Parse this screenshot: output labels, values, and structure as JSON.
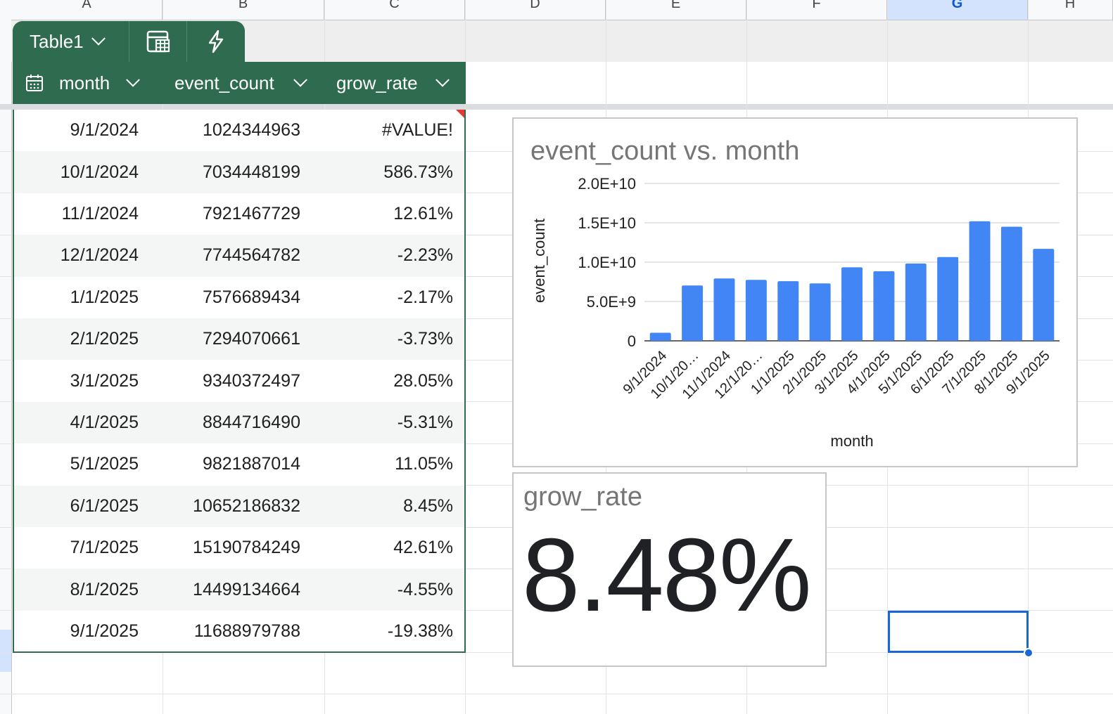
{
  "columns": [
    "A",
    "B",
    "C",
    "D",
    "E",
    "F",
    "G",
    "H"
  ],
  "selected_column": "G",
  "table": {
    "name": "Table1",
    "headers": [
      "month",
      "event_count",
      "grow_rate"
    ],
    "rows": [
      [
        "9/1/2024",
        "1024344963",
        "#VALUE!"
      ],
      [
        "10/1/2024",
        "7034448199",
        "586.73%"
      ],
      [
        "11/1/2024",
        "7921467729",
        "12.61%"
      ],
      [
        "12/1/2024",
        "7744564782",
        "-2.23%"
      ],
      [
        "1/1/2025",
        "7576689434",
        "-2.17%"
      ],
      [
        "2/1/2025",
        "7294070661",
        "-3.73%"
      ],
      [
        "3/1/2025",
        "9340372497",
        "28.05%"
      ],
      [
        "4/1/2025",
        "8844716490",
        "-5.31%"
      ],
      [
        "5/1/2025",
        "9821887014",
        "11.05%"
      ],
      [
        "6/1/2025",
        "10652186832",
        "8.45%"
      ],
      [
        "7/1/2025",
        "15190784249",
        "42.61%"
      ],
      [
        "8/1/2025",
        "14499134664",
        "-4.55%"
      ],
      [
        "9/1/2025",
        "11688979788",
        "-19.38%"
      ]
    ]
  },
  "chart_data": {
    "type": "bar",
    "title": "event_count vs. month",
    "xlabel": "month",
    "ylabel": "event_count",
    "categories": [
      "9/1/2024",
      "10/1/20…",
      "11/1/2024",
      "12/1/20…",
      "1/1/2025",
      "2/1/2025",
      "3/1/2025",
      "4/1/2025",
      "5/1/2025",
      "6/1/2025",
      "7/1/2025",
      "8/1/2025",
      "9/1/2025"
    ],
    "values": [
      1024344963,
      7034448199,
      7921467729,
      7744564782,
      7576689434,
      7294070661,
      9340372497,
      8844716490,
      9821887014,
      10652186832,
      15190784249,
      14499134664,
      11688979788
    ],
    "yticks": [
      "0",
      "5.0E+9",
      "1.0E+10",
      "1.5E+10",
      "2.0E+10"
    ],
    "ylim": [
      0,
      20000000000
    ],
    "bar_color": "#4285f4",
    "grid": true
  },
  "scorecard": {
    "title": "grow_rate",
    "value": "8.48%"
  },
  "colors": {
    "table_header": "#2e6b4f",
    "selection": "#1a66d2"
  }
}
